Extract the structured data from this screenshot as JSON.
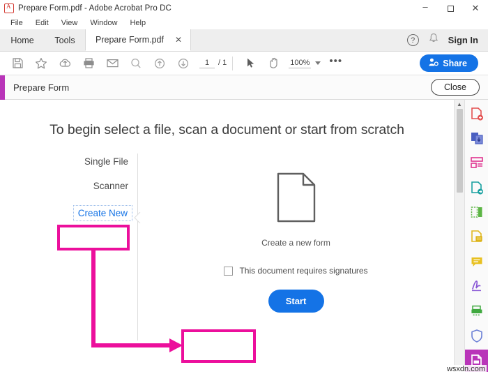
{
  "window": {
    "title": "Prepare Form.pdf - Adobe Acrobat Pro DC",
    "app_icon": "pdf-document-icon",
    "minimize": "–",
    "maximize": "□",
    "close": "✕"
  },
  "menu": {
    "items": [
      {
        "label": "File"
      },
      {
        "label": "Edit"
      },
      {
        "label": "View"
      },
      {
        "label": "Window"
      },
      {
        "label": "Help"
      }
    ]
  },
  "tabs": {
    "home": "Home",
    "tools": "Tools",
    "document": "Prepare Form.pdf",
    "document_close": "✕",
    "help_icon": "?",
    "bell_icon": "notification-bell-icon",
    "sign_in": "Sign In"
  },
  "toolbar": {
    "icons": [
      {
        "name": "save-icon"
      },
      {
        "name": "star-icon"
      },
      {
        "name": "cloud-upload-icon"
      },
      {
        "name": "print-icon"
      },
      {
        "name": "email-icon"
      },
      {
        "name": "search-icon"
      },
      {
        "name": "previous-page-icon"
      },
      {
        "name": "next-page-icon"
      }
    ],
    "page_current": "1",
    "page_total": "/ 1",
    "select_tool": "cursor-arrow-icon",
    "hand_tool": "hand-icon",
    "zoom_level": "100%",
    "more_options": "•••",
    "share_label": "Share"
  },
  "prepare_form_bar": {
    "title": "Prepare Form",
    "close_label": "Close",
    "accent_color": "#b935b9"
  },
  "main": {
    "headline": "To begin select a file, scan a document or start from scratch",
    "options": [
      {
        "label": "Single File",
        "selected": false
      },
      {
        "label": "Scanner",
        "selected": false
      },
      {
        "label": "Create New",
        "selected": true
      }
    ],
    "preview": {
      "icon": "blank-document-icon",
      "caption": "Create a new form"
    },
    "signature_checkbox": {
      "label": "This document requires signatures",
      "checked": false
    },
    "start_label": "Start"
  },
  "scrollbar": {
    "up_arrow": "▲"
  },
  "tool_rail": {
    "items": [
      {
        "name": "create-pdf-icon",
        "color": "#e34f4f",
        "active": false
      },
      {
        "name": "combine-files-icon",
        "color": "#4a5fc1",
        "active": false
      },
      {
        "name": "organize-pages-icon",
        "color": "#e0328f",
        "active": false
      },
      {
        "name": "export-pdf-icon",
        "color": "#18a0a0",
        "active": false
      },
      {
        "name": "edit-pdf-icon",
        "color": "#5cb544",
        "active": false
      },
      {
        "name": "fill-and-sign-icon",
        "color": "#e8c020",
        "active": false
      },
      {
        "name": "comment-icon",
        "color": "#e8c020",
        "active": false
      },
      {
        "name": "signature-icon",
        "color": "#8a58d6",
        "active": false
      },
      {
        "name": "scan-and-ocr-icon",
        "color": "#3fa93f",
        "active": false
      },
      {
        "name": "protect-icon",
        "color": "#6a7fd6",
        "active": false
      },
      {
        "name": "prepare-form-icon",
        "color": "#ffffff",
        "active": true
      }
    ]
  },
  "annotations": {
    "highlight_color": "#ec0f9c",
    "create_new_box": "Create New",
    "start_box": "Start"
  },
  "watermark": "wsxdn.com"
}
